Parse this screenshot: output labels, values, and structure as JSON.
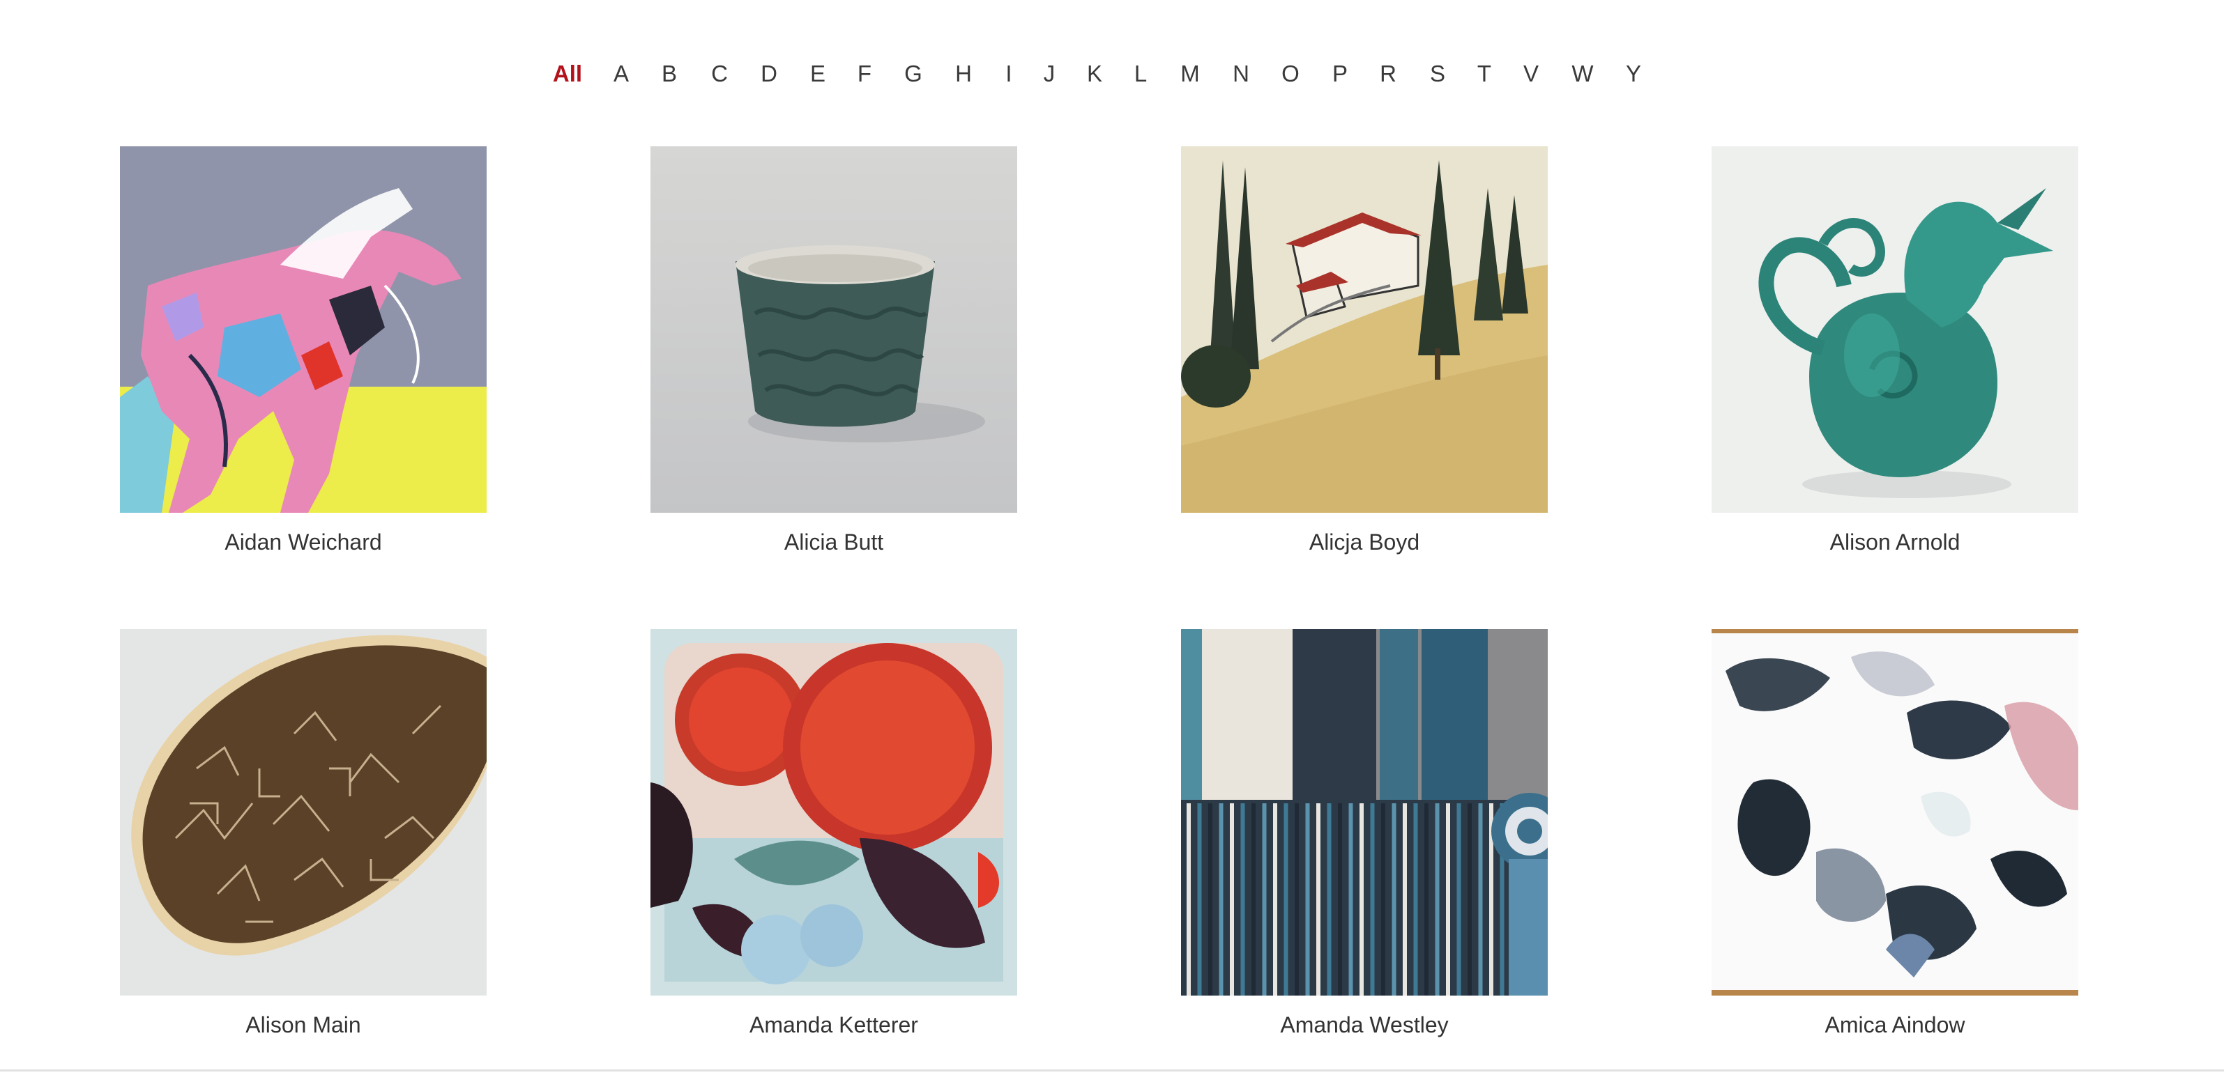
{
  "filter": {
    "letters": [
      "All",
      "A",
      "B",
      "C",
      "D",
      "E",
      "F",
      "G",
      "H",
      "I",
      "J",
      "K",
      "L",
      "M",
      "N",
      "O",
      "P",
      "R",
      "S",
      "T",
      "V",
      "W",
      "Y"
    ],
    "active": "All",
    "active_color": "#b3121b"
  },
  "artists": [
    {
      "name": "Aidan Weichard",
      "image": "horse-painting"
    },
    {
      "name": "Alicia Butt",
      "image": "ceramic-cup"
    },
    {
      "name": "Alicja Boyd",
      "image": "tuscan-landscape"
    },
    {
      "name": "Alison Arnold",
      "image": "bird-jug"
    },
    {
      "name": "Alison Main",
      "image": "brown-platter"
    },
    {
      "name": "Amanda Ketterer",
      "image": "red-flowers-painting"
    },
    {
      "name": "Amanda Westley",
      "image": "woven-textile"
    },
    {
      "name": "Amica Aindow",
      "image": "ink-abstract"
    }
  ]
}
